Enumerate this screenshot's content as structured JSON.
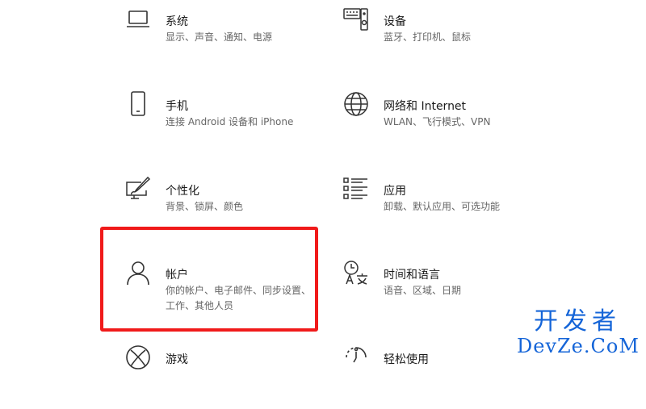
{
  "tiles": [
    {
      "title": "系统",
      "desc": "显示、声音、通知、电源",
      "icon": "laptop-icon"
    },
    {
      "title": "设备",
      "desc": "蓝牙、打印机、鼠标",
      "icon": "keyboard-speaker-icon"
    },
    {
      "title": "手机",
      "desc": "连接 Android 设备和 iPhone",
      "icon": "phone-icon"
    },
    {
      "title": "网络和 Internet",
      "desc": "WLAN、飞行模式、VPN",
      "icon": "globe-icon"
    },
    {
      "title": "个性化",
      "desc": "背景、锁屏、颜色",
      "icon": "paint-monitor-icon"
    },
    {
      "title": "应用",
      "desc": "卸载、默认应用、可选功能",
      "icon": "apps-list-icon"
    },
    {
      "title": "帐户",
      "desc": "你的帐户、电子邮件、同步设置、工作、其他人员",
      "icon": "person-icon"
    },
    {
      "title": "时间和语言",
      "desc": "语音、区域、日期",
      "icon": "time-language-icon"
    },
    {
      "title": "游戏",
      "desc": "",
      "icon": "xbox-icon"
    },
    {
      "title": "轻松使用",
      "desc": "",
      "icon": "ease-of-access-icon"
    }
  ],
  "highlight_color": "#f01a1a",
  "watermark": {
    "line1": "开发者",
    "line2": "DevZe.CoM",
    "color": "#1565d8"
  }
}
